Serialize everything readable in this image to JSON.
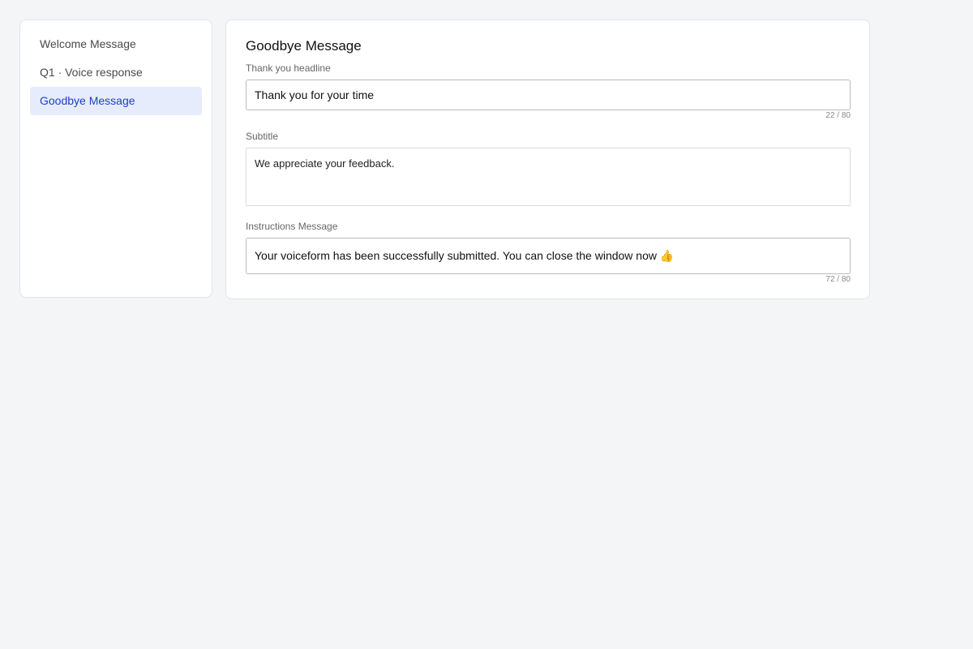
{
  "sidebar": {
    "items": [
      {
        "label": "Welcome Message",
        "active": false
      },
      {
        "label": "Q1 · Voice response",
        "active": false
      },
      {
        "label": "Goodbye Message",
        "active": true
      }
    ]
  },
  "main": {
    "title": "Goodbye Message",
    "headline": {
      "label": "Thank you headline",
      "value": "Thank you for your time",
      "counter": "22 / 80"
    },
    "subtitle": {
      "label": "Subtitle",
      "value": "We appreciate your feedback."
    },
    "instructions": {
      "label": "Instructions Message",
      "value": "Your voiceform has been successfully submitted. You can close the window now 👍",
      "counter": "72 / 80"
    }
  },
  "colors": {
    "background": "#f4f5f7",
    "active_item_bg": "#e6ecfb",
    "active_item_text": "#1f3fc4"
  }
}
